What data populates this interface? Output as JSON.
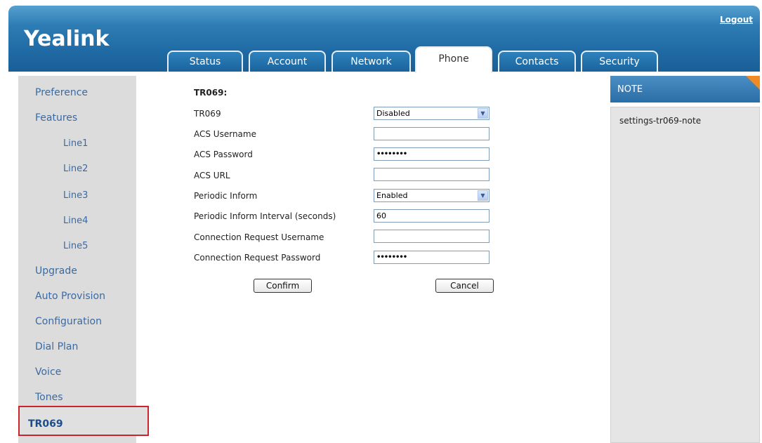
{
  "header": {
    "logo": "Yealink",
    "logout": "Logout",
    "tabs": [
      "Status",
      "Account",
      "Network",
      "Phone",
      "Contacts",
      "Security"
    ],
    "active_tab": "Phone"
  },
  "sidebar": {
    "items": [
      "Preference",
      "Features",
      "Line1",
      "Line2",
      "Line3",
      "Line4",
      "Line5",
      "Upgrade",
      "Auto Provision",
      "Configuration",
      "Dial Plan",
      "Voice",
      "Tones",
      "TR069"
    ],
    "selected": "TR069"
  },
  "form": {
    "section_title": "TR069:",
    "fields": [
      {
        "label": "TR069",
        "type": "select",
        "value": "Disabled"
      },
      {
        "label": "ACS Username",
        "type": "text",
        "value": ""
      },
      {
        "label": "ACS Password",
        "type": "password",
        "value": "••••••••"
      },
      {
        "label": "ACS URL",
        "type": "text",
        "value": ""
      },
      {
        "label": "Periodic Inform",
        "type": "select",
        "value": "Enabled"
      },
      {
        "label": "Periodic Inform Interval (seconds)",
        "type": "text",
        "value": "60"
      },
      {
        "label": "Connection Request Username",
        "type": "text",
        "value": ""
      },
      {
        "label": "Connection Request Password",
        "type": "password",
        "value": "••••••••"
      }
    ],
    "confirm_label": "Confirm",
    "cancel_label": "Cancel"
  },
  "note": {
    "title": "NOTE",
    "text": "settings-tr069-note"
  },
  "colors": {
    "header_blue": "#1f6aa4",
    "sidebar_link": "#3a6aa3",
    "highlight_border": "#c8262c",
    "note_corner": "#f08a24"
  }
}
